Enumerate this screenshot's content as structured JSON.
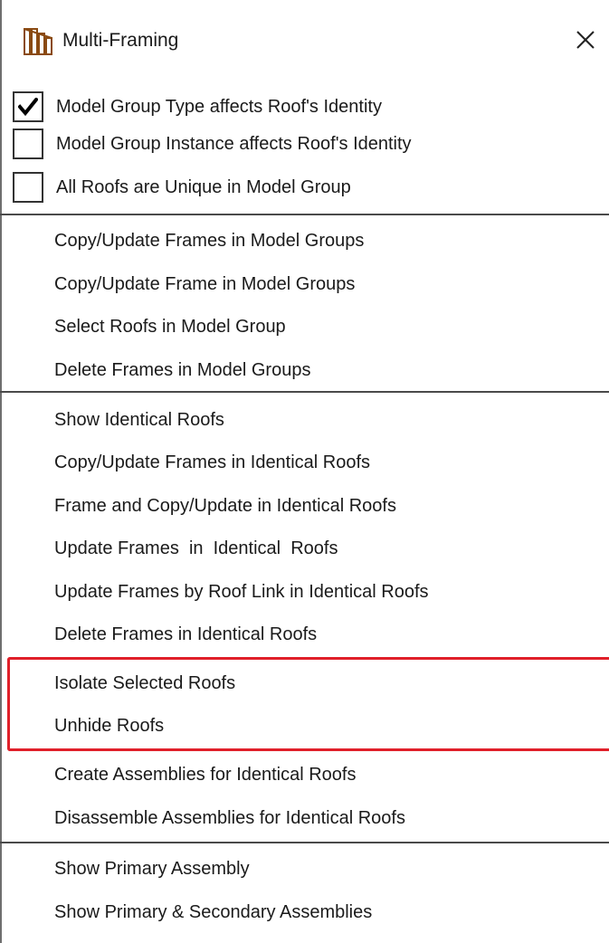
{
  "window": {
    "title": "Multi-Framing",
    "icon": "multi-framing-icon",
    "close_icon": "close-icon"
  },
  "checkboxes": [
    {
      "label": "Model Group Type affects Roof's Identity",
      "checked": true
    },
    {
      "label": "Model Group Instance affects Roof's Identity",
      "checked": false
    },
    {
      "label": "All Roofs are Unique in Model Group",
      "checked": false
    }
  ],
  "groups": [
    {
      "items": [
        {
          "label": "Copy/Update Frames in Model Groups"
        },
        {
          "label": "Copy/Update Frame in Model Groups"
        },
        {
          "label": "Select Roofs in Model Group"
        },
        {
          "label": "Delete Frames in Model Groups"
        }
      ]
    },
    {
      "items": [
        {
          "label": "Show Identical Roofs"
        },
        {
          "label": "Copy/Update Frames in Identical Roofs"
        },
        {
          "label": "Frame and Copy/Update in Identical Roofs"
        },
        {
          "label": "Update Frames  in  Identical  Roofs"
        },
        {
          "label": "Update Frames by Roof Link in Identical Roofs"
        },
        {
          "label": "Delete Frames in Identical Roofs"
        },
        {
          "label": "Isolate Selected Roofs",
          "highlighted": true
        },
        {
          "label": "Unhide Roofs",
          "highlighted": true
        },
        {
          "label": "Create Assemblies for Identical Roofs"
        },
        {
          "label": "Disassemble Assemblies for Identical Roofs"
        }
      ]
    },
    {
      "items": [
        {
          "label": "Show Primary Assembly"
        },
        {
          "label": "Show Primary & Secondary Assemblies"
        }
      ]
    }
  ],
  "colors": {
    "highlight_border": "#e0202a",
    "separator": "#4a4a4a",
    "text": "#1a1a1a"
  }
}
